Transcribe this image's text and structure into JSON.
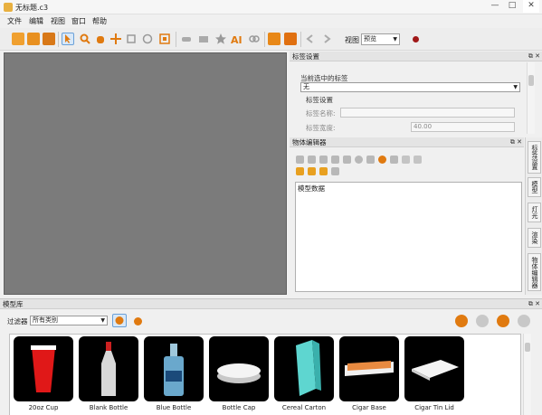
{
  "window": {
    "title": "无标题.c3",
    "minimize": "—",
    "maximize": "□",
    "close": "✕"
  },
  "menu": [
    "文件",
    "编辑",
    "视图",
    "窗口",
    "帮助"
  ],
  "toolbar": {
    "icons": [
      "new-file-icon",
      "open-folder-icon",
      "save-icon",
      "select-arrow-icon",
      "zoom-icon",
      "pan-hand-icon",
      "move-icon",
      "scale-icon",
      "rotate-icon",
      "fit-view-icon",
      "tag-icon",
      "envelope-icon",
      "star-icon",
      "text-ai-icon",
      "link-icon",
      "render-icon",
      "camera-icon",
      "back-arrow-icon",
      "forward-arrow-icon"
    ],
    "view_label": "视图",
    "view_value": "预览",
    "colors": {
      "accent": "#e07a10",
      "record": "#a01818"
    }
  },
  "tag_settings": {
    "title": "标签设置",
    "current_label": "当前选中的标签",
    "current_value": "无",
    "group_label": "标签设置",
    "name_label": "标签名称:",
    "name_value": "",
    "width_label": "标签宽度:",
    "width_value": "40.00"
  },
  "object_editor": {
    "title": "物体编辑器",
    "tree_root": "模型数据"
  },
  "side_tabs": [
    "标签设置",
    "模型",
    "灯光",
    "渲染",
    "物体编辑器"
  ],
  "model_library": {
    "title": "模型库",
    "filter_label": "过滤器",
    "filter_value": "所有类别",
    "models": [
      {
        "name": "20oz Cup",
        "icon": "red-cup-icon"
      },
      {
        "name": "Blank Bottle",
        "icon": "bottle-icon"
      },
      {
        "name": "Blue Bottle",
        "icon": "blue-bottle-icon"
      },
      {
        "name": "Bottle Cap",
        "icon": "bottle-cap-icon"
      },
      {
        "name": "Cereal Carton",
        "icon": "carton-icon"
      },
      {
        "name": "Cigar Base",
        "icon": "cigar-base-icon"
      },
      {
        "name": "Cigar Tin Lid",
        "icon": "cigar-lid-icon"
      }
    ]
  }
}
